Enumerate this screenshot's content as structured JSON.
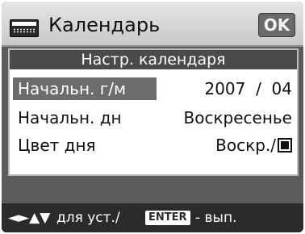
{
  "header": {
    "icon": "calendar-icon",
    "title": "Календарь",
    "ok_label": "OK"
  },
  "panel": {
    "title": "Настр. календаря",
    "rows": [
      {
        "label": "Начальн. г/м",
        "value": "2007  /  04",
        "selected": true
      },
      {
        "label": "Начальн. дн",
        "value": "Воскресенье",
        "selected": false
      },
      {
        "label": "Цвет дня",
        "value": "Воскр./",
        "selected": false,
        "swatch_color": "#111111"
      }
    ]
  },
  "footer": {
    "arrows": "◄►▲▼",
    "hint_set": "для уст./",
    "enter_key": "ENTER",
    "hint_exec": "- вып."
  },
  "colors": {
    "background": "#5b5b5b",
    "header": "#d6d6d6",
    "selection": "#6c6c6c",
    "footer": "#2b2b2b"
  }
}
